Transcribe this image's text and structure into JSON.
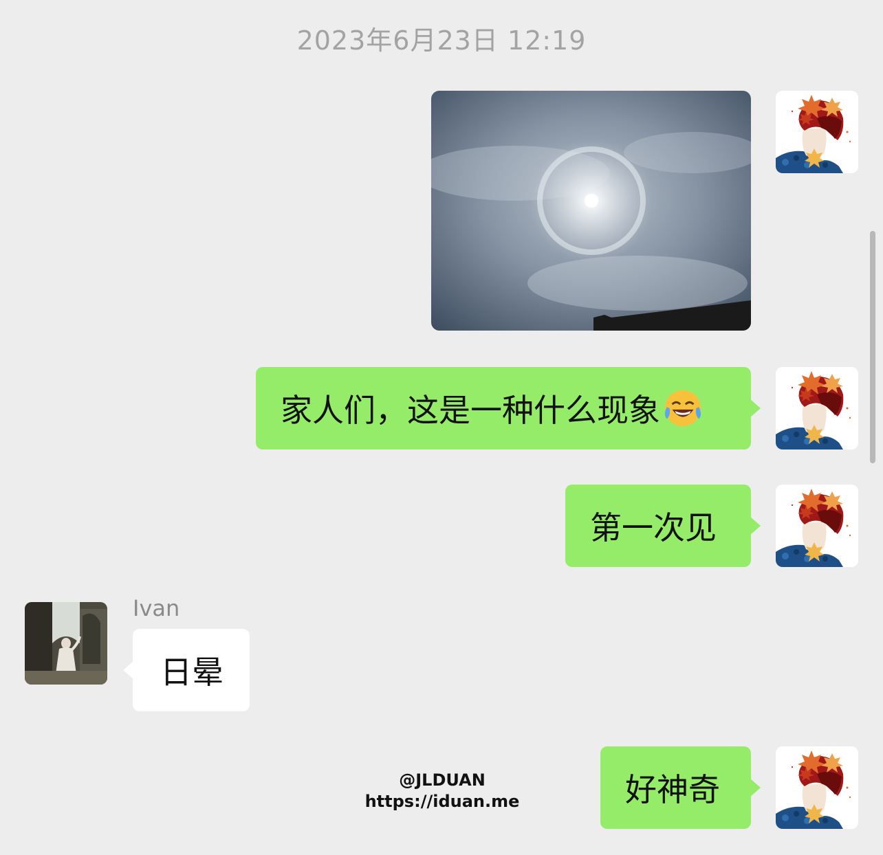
{
  "chat": {
    "timestamp": "2023年6月23日 12:19",
    "messages": [
      {
        "direction": "outgoing",
        "type": "image",
        "image_icon": "sun-halo-photo",
        "avatar_icon": "maple-leaf-portrait-avatar"
      },
      {
        "direction": "outgoing",
        "type": "text",
        "text": "家人们，这是一种什么现象",
        "emoji": "tears-of-joy",
        "avatar_icon": "maple-leaf-portrait-avatar"
      },
      {
        "direction": "outgoing",
        "type": "text",
        "text": "第一次见",
        "avatar_icon": "maple-leaf-portrait-avatar"
      },
      {
        "direction": "incoming",
        "type": "text",
        "sender": "Ivan",
        "text": "日晕",
        "avatar_icon": "photo-avatar"
      },
      {
        "direction": "outgoing",
        "type": "text",
        "text": "好神奇",
        "avatar_icon": "maple-leaf-portrait-avatar"
      }
    ]
  },
  "watermark": {
    "handle": "@JLDUAN",
    "url": "https://iduan.me"
  },
  "colors": {
    "background": "#ededed",
    "outgoing_bubble": "#95ec69",
    "incoming_bubble": "#ffffff",
    "timestamp_text": "#a3a3a3",
    "sender_name": "#8a8a8a"
  }
}
